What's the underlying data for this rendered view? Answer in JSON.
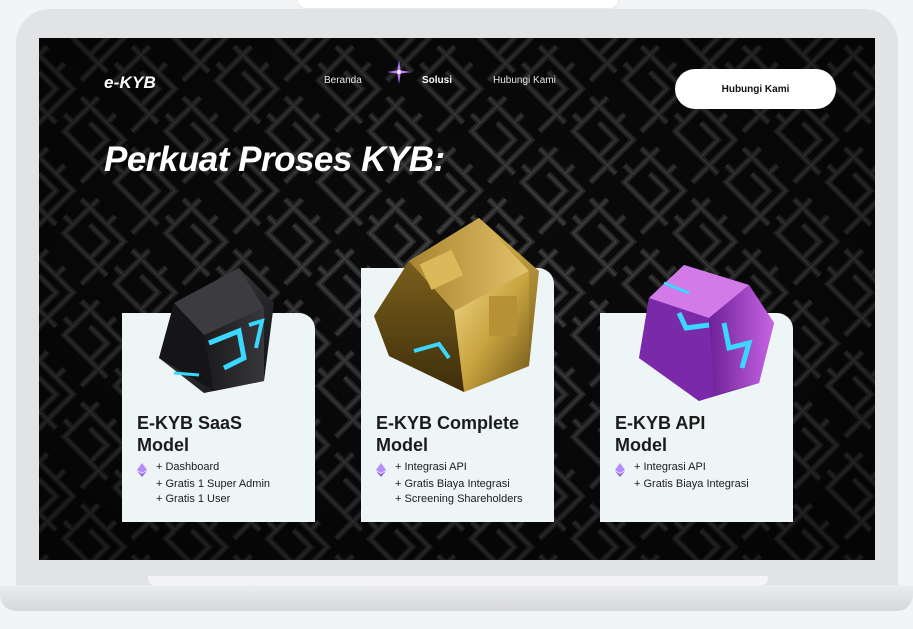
{
  "nav": {
    "logo": "e-KYB",
    "links": [
      "Beranda",
      "Solusi",
      "Hubungi Kami"
    ],
    "cta": "Hubungi Kami"
  },
  "hero": {
    "title": "Perkuat Proses KYB:"
  },
  "cards": [
    {
      "title_line1": "E-KYB SaaS",
      "title_line2": "Model",
      "features": [
        "+ Dashboard",
        "+ Gratis 1 Super Admin",
        "+ Gratis 1 User"
      ],
      "cube_icon": "black-cube-icon"
    },
    {
      "title_line1": "E-KYB Complete",
      "title_line2": "Model",
      "features": [
        "+ Integrasi API",
        "+ Gratis Biaya Integrasi",
        "+ Screening Shareholders"
      ],
      "cube_icon": "gold-cube-icon"
    },
    {
      "title_line1": "E-KYB API",
      "title_line2": "Model",
      "features": [
        "+ Integrasi API",
        "+ Gratis Biaya Integrasi"
      ],
      "cube_icon": "purple-cube-icon"
    }
  ],
  "colors": {
    "screen_bg": "#0a0a0a",
    "card_bg": "#eef5f7",
    "accent_purple": "#a070e0",
    "accent_cyan": "#3ad7ff",
    "gold": "#c9a440"
  }
}
